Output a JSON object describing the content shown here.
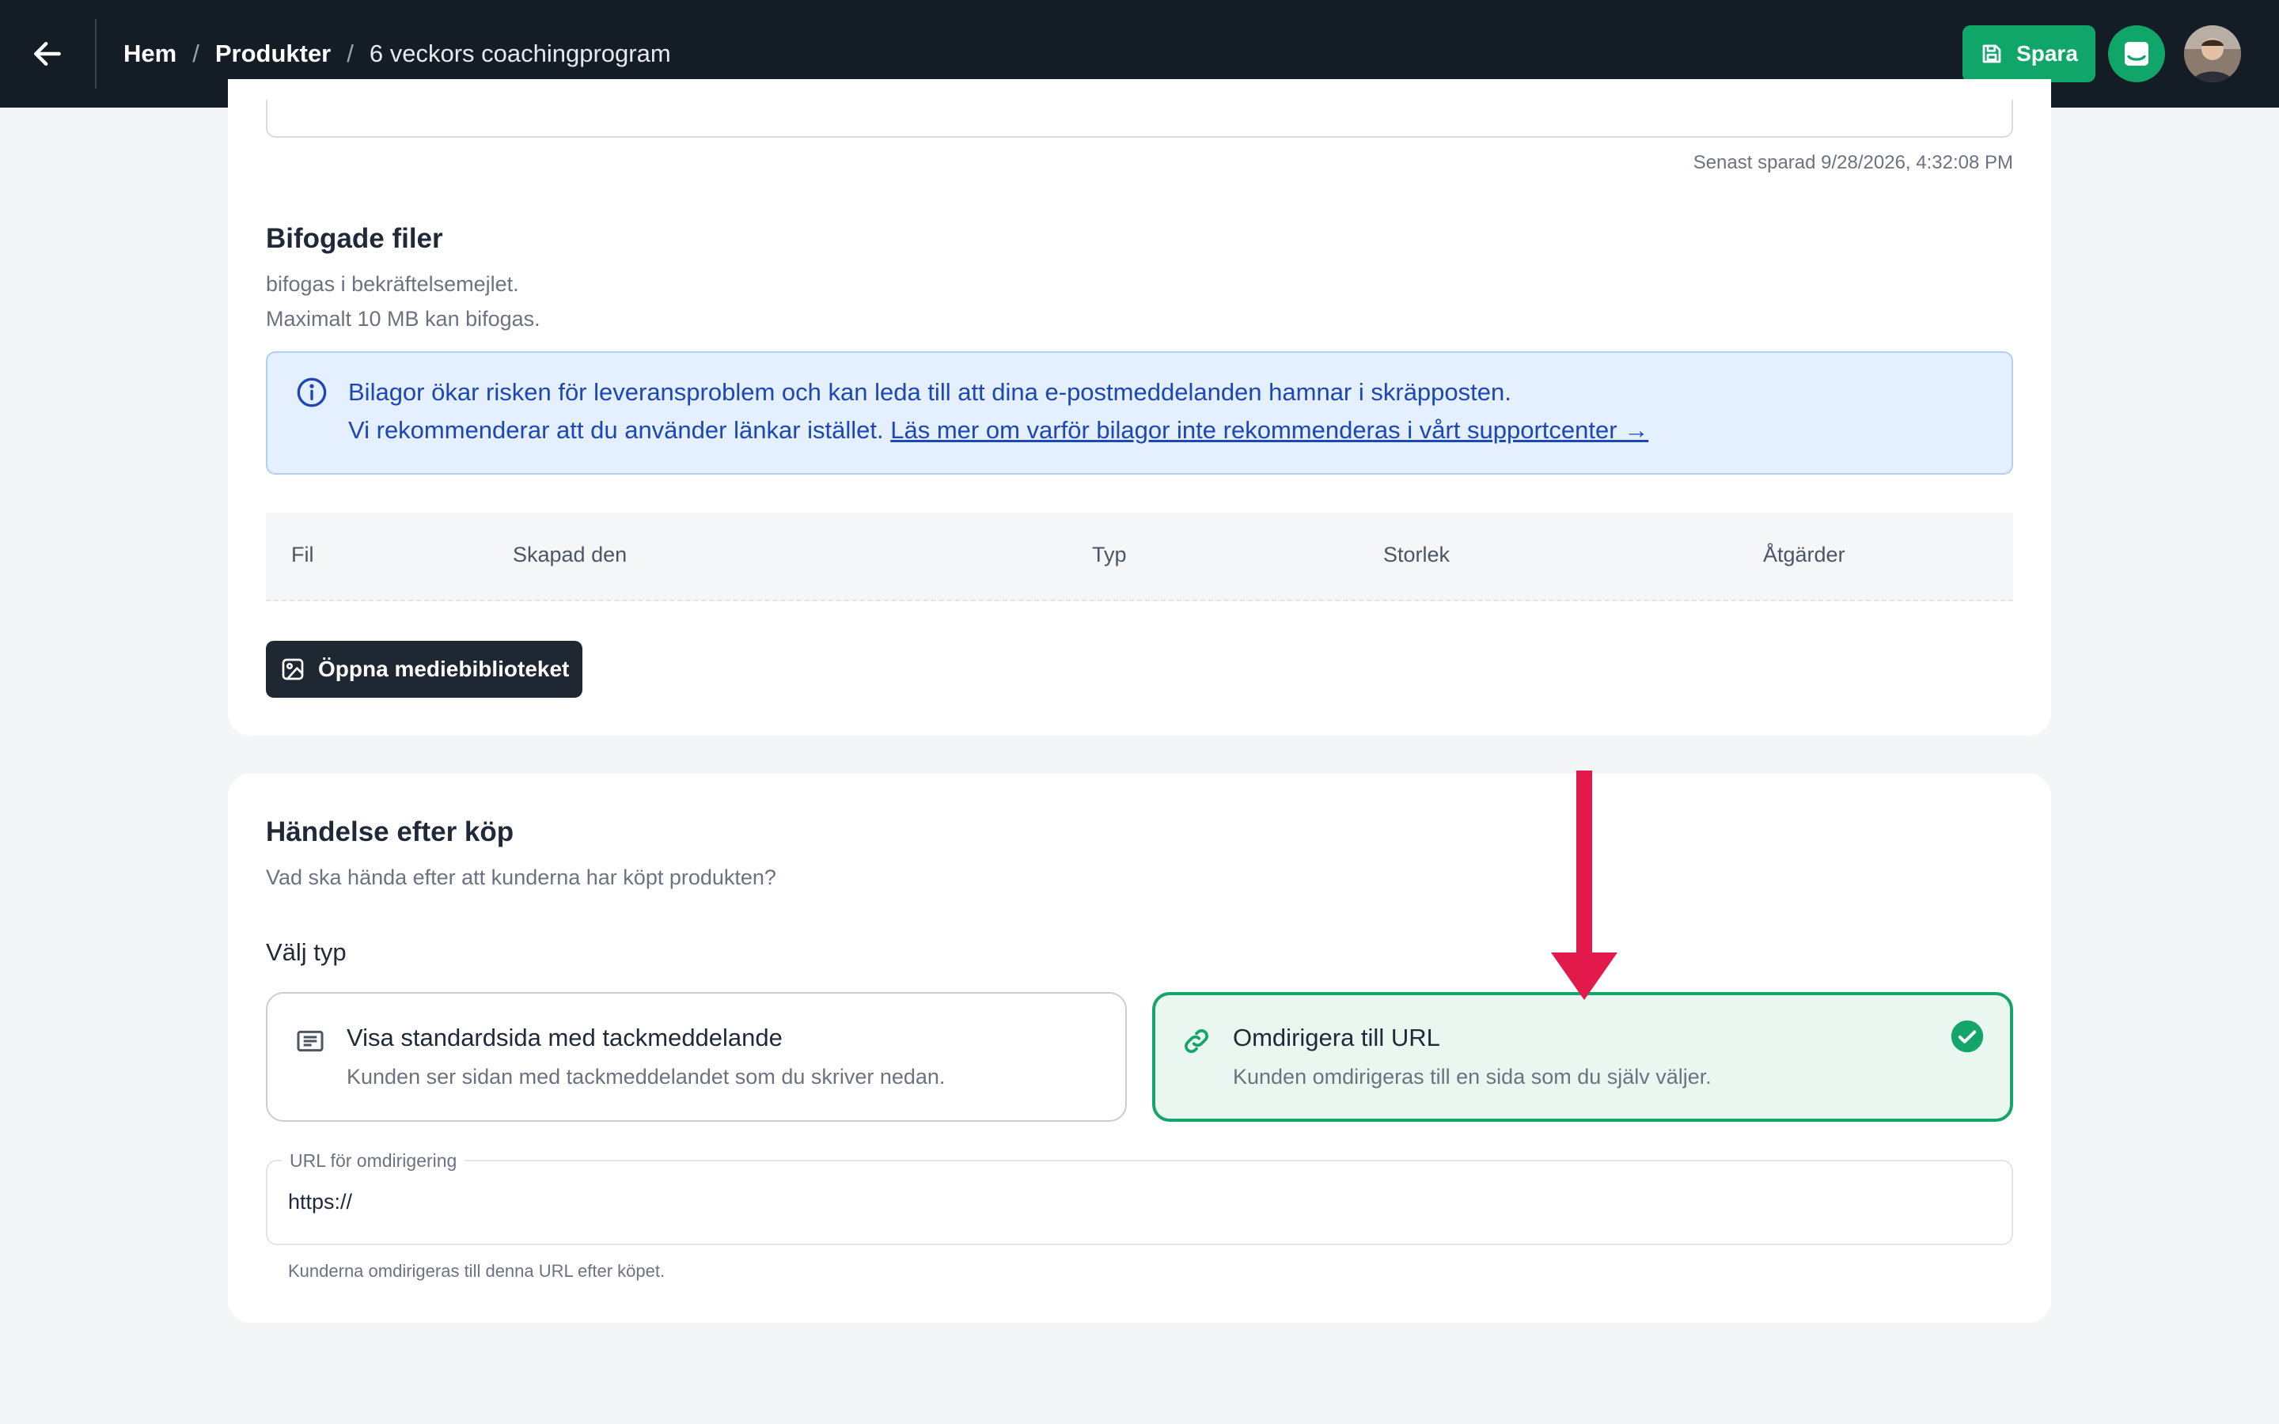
{
  "header": {
    "breadcrumb": {
      "home": "Hem",
      "products": "Produkter",
      "current": "6 veckors coachingprogram",
      "separator": "/"
    },
    "save_label": "Spara",
    "accent": "#10a569"
  },
  "attachments": {
    "last_saved": "Senast sparad 9/28/2026, 4:32:08 PM",
    "title": "Bifogade filer",
    "description": "bifogas i bekräftelsemejlet.",
    "limit": "Maximalt 10 MB kan bifogas.",
    "info": {
      "line1": "Bilagor ökar risken för leveransproblem och kan leda till att dina e-postmeddelanden hamnar i skräpposten.",
      "line2_prefix": "Vi rekommenderar att du använder länkar istället.",
      "link": "Läs mer om varför bilagor inte rekommenderas i vårt supportcenter →"
    },
    "columns": [
      "Fil",
      "Skapad den",
      "Typ",
      "Storlek",
      "Åtgärder"
    ],
    "media_button": "Öppna mediebiblioteket"
  },
  "post_purchase": {
    "title": "Händelse efter köp",
    "description": "Vad ska hända efter att kunderna har köpt produkten?",
    "type_label": "Välj typ",
    "options": [
      {
        "title": "Visa standardsida med tackmeddelande",
        "description": "Kunden ser sidan med tackmeddelandet som du skriver nedan.",
        "icon": "text-page-icon",
        "selected": false
      },
      {
        "title": "Omdirigera till URL",
        "description": "Kunden omdirigeras till en sida som du själv väljer.",
        "icon": "link-icon",
        "selected": true
      }
    ],
    "url_field": {
      "label": "URL för omdirigering",
      "value": "https://",
      "help": "Kunderna omdirigeras till denna URL efter köpet."
    }
  },
  "annotation": {
    "arrow_color": "#e3194b"
  }
}
